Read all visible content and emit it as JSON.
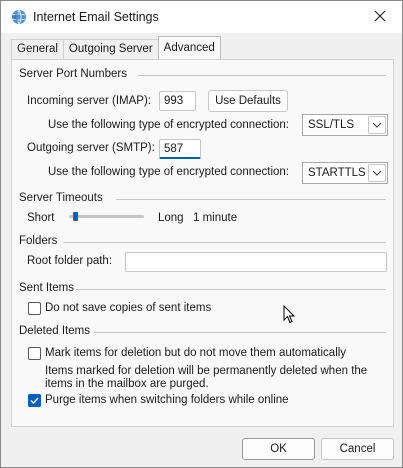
{
  "window": {
    "title": "Internet Email Settings"
  },
  "tabs": [
    {
      "label": "General"
    },
    {
      "label": "Outgoing Server"
    },
    {
      "label": "Advanced"
    }
  ],
  "server_ports": {
    "section_title": "Server Port Numbers",
    "incoming_label": "Incoming server (IMAP):",
    "incoming_value": "993",
    "use_defaults_label": "Use Defaults",
    "incoming_encryption_label": "Use the following type of encrypted connection:",
    "incoming_encryption_value": "SSL/TLS",
    "outgoing_label": "Outgoing server (SMTP):",
    "outgoing_value": "587",
    "outgoing_encryption_label": "Use the following type of encrypted connection:",
    "outgoing_encryption_value": "STARTTLS"
  },
  "server_timeouts": {
    "section_title": "Server Timeouts",
    "short_label": "Short",
    "long_label": "Long",
    "value_label": "1 minute",
    "slider_fraction": 0.08
  },
  "folders": {
    "section_title": "Folders",
    "root_folder_label": "Root folder path:",
    "root_folder_value": ""
  },
  "sent_items": {
    "section_title": "Sent Items",
    "do_not_save_label": "Do not save copies of sent items",
    "do_not_save_checked": false
  },
  "deleted_items": {
    "section_title": "Deleted Items",
    "mark_for_deletion_label": "Mark items for deletion but do not move them automatically",
    "mark_for_deletion_checked": false,
    "note_line1": "Items marked for deletion will be permanently deleted when the",
    "note_line2": "items in the mailbox are purged.",
    "purge_label": "Purge items when switching folders while online",
    "purge_checked": true
  },
  "footer": {
    "ok_label": "OK",
    "cancel_label": "Cancel"
  },
  "colors": {
    "accent": "#005fb8"
  },
  "icons": {
    "app": "outlook-globe-icon",
    "close": "close-icon",
    "dropdown": "chevron-down-icon",
    "check": "check-icon",
    "cursor": "mouse-pointer-icon"
  }
}
